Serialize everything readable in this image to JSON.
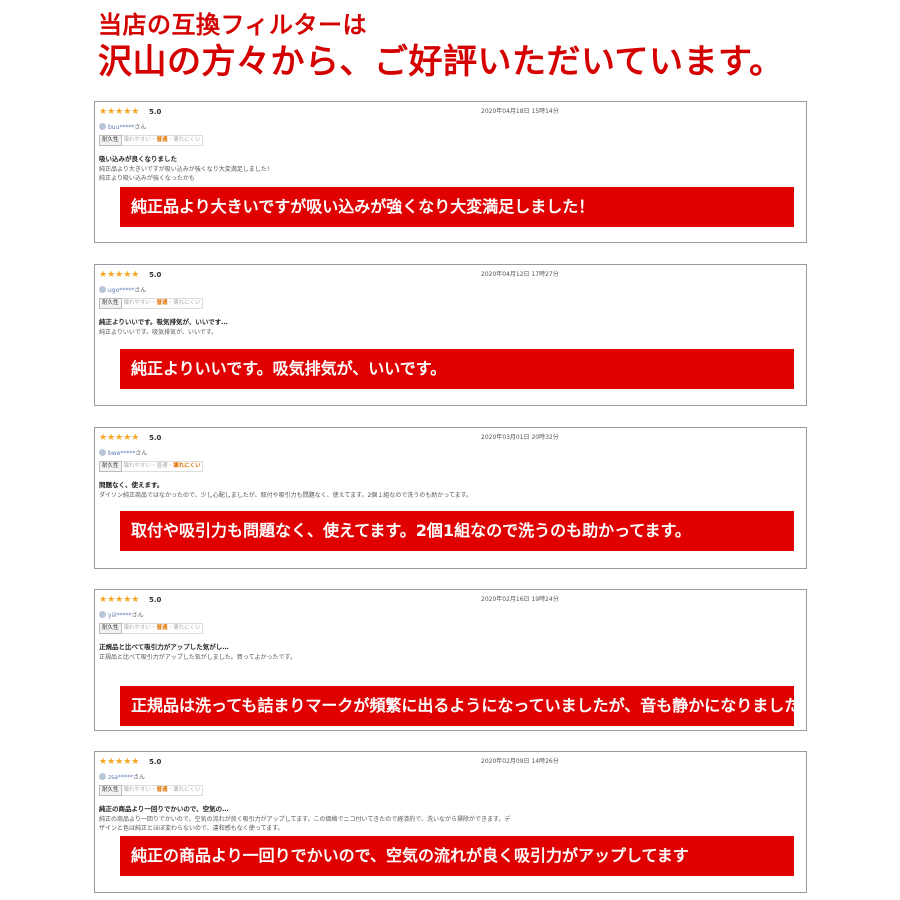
{
  "header": {
    "line1": "当店の互換フィルターは",
    "line2": "沢山の方々から、ご好評いただいています。"
  },
  "durability": {
    "label": "耐久性",
    "options": [
      "壊れやすい",
      "普通",
      "壊れにくい"
    ],
    "separator": "・"
  },
  "reviews": [
    {
      "stars": "★★★★★",
      "rating": "5.0",
      "date": "2020年04月18日 15時14分",
      "user": "buu*****",
      "user_suffix": "さん",
      "durability_selected": "普通",
      "title": "吸い込みが良くなりました",
      "body_lines": [
        "純正品より大きいですが吸い込みが強くなり大変満足しました！",
        "純正より吸い込みが強くなったかも"
      ],
      "highlight": "純正品より大きいですが吸い込みが強くなり大変満足しました！"
    },
    {
      "stars": "★★★★★",
      "rating": "5.0",
      "date": "2020年04月12日 17時27分",
      "user": "ugo*****",
      "user_suffix": "さん",
      "durability_selected": "普通",
      "title": "純正よりいいです。吸気排気が、いいです…",
      "body_lines": [
        "純正よりいいです。吸気排気が、いいです。"
      ],
      "highlight": "純正よりいいです。吸気排気が、いいです。"
    },
    {
      "stars": "★★★★★",
      "rating": "5.0",
      "date": "2020年03月01日 20時32分",
      "user": "bwe*****",
      "user_suffix": "さん",
      "durability_selected": "壊れにくい",
      "title": "問題なく、使えます。",
      "body_lines": [
        "ダイソン純正商品ではなかったので、少し心配しましたが、取付や吸引力も問題なく、使えてます。2個１組なので洗うのも助かってます。"
      ],
      "highlight": "取付や吸引力も問題なく、使えてます。2個1組なので洗うのも助かってます。"
    },
    {
      "stars": "★★★★★",
      "rating": "5.0",
      "date": "2020年02月16日 19時24分",
      "user": "yiii*****",
      "user_suffix": "さん",
      "durability_selected": "普通",
      "title": "正規品と比べて吸引力がアップした気がし…",
      "body_lines": [
        "正規品と比べて吸引力がアップした気がしました。買ってよかったです。"
      ],
      "highlight": "正規品は洗っても詰まりマークが頻繁に出るようになっていましたが、音も静かになりました。"
    },
    {
      "stars": "★★★★★",
      "rating": "5.0",
      "date": "2020年02月09日 14時26分",
      "user": "zsa*****",
      "user_suffix": "さん",
      "durability_selected": "普通",
      "title": "純正の商品より一回りでかいので、空気の…",
      "body_lines": [
        "純正の商品より一回りでかいので、空気の流れが良く吸引力がアップしてます。この価格でニコ付いてきたので経済的で、洗いながら掃除ができます。デ",
        "ザインと色は純正とほぼ変わらないので、違和感もなく使ってます。"
      ],
      "highlight": "純正の商品より一回りでかいので、空気の流れが良く吸引力がアップしてます"
    }
  ]
}
